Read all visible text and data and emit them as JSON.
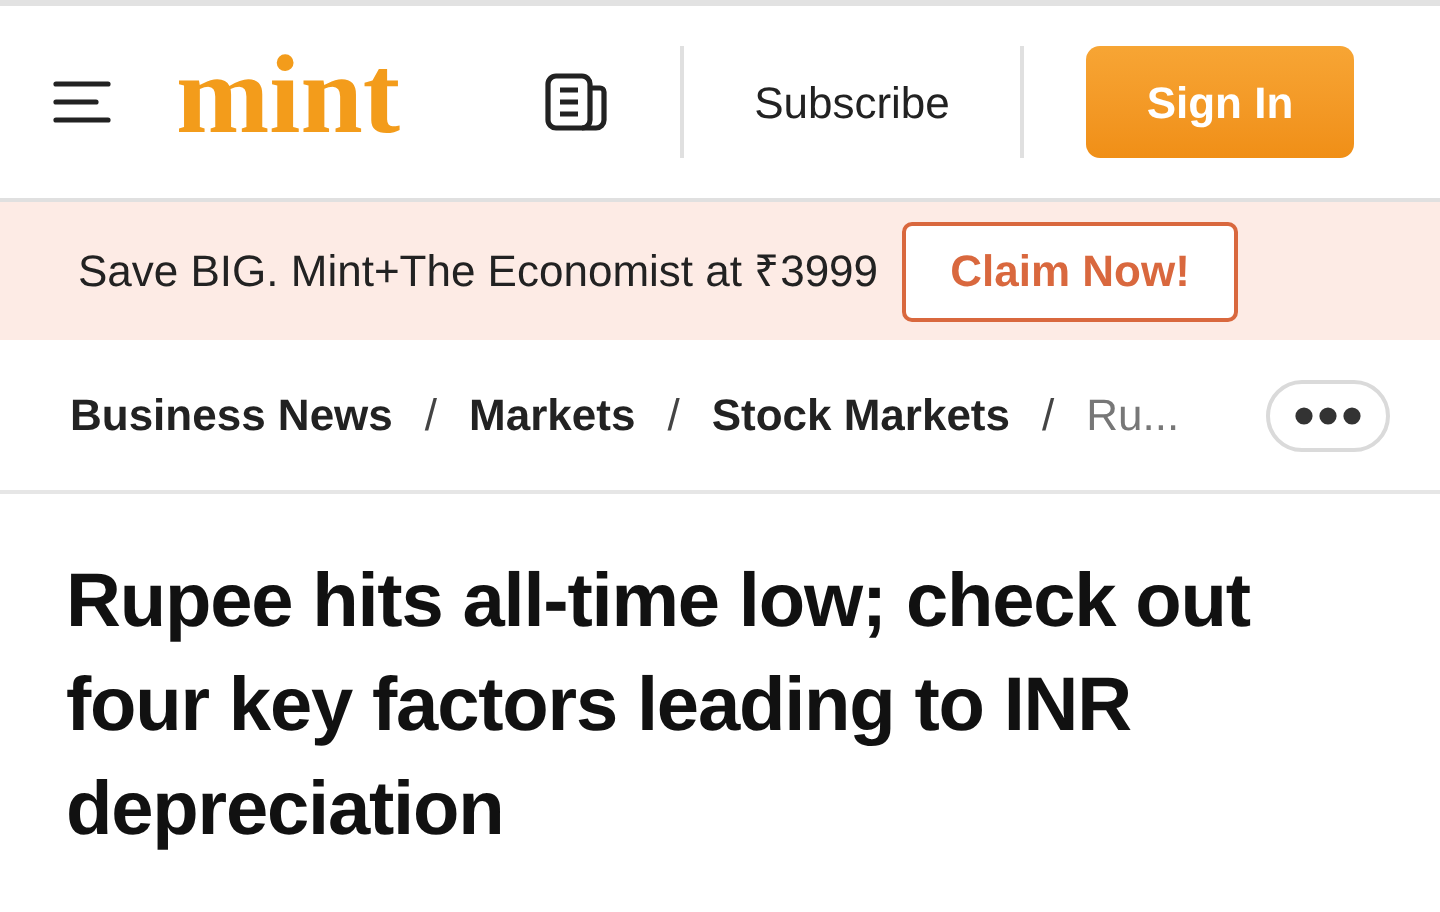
{
  "header": {
    "logo": "mint",
    "subscribe": "Subscribe",
    "sign_in": "Sign In"
  },
  "promo": {
    "text": "Save BIG. Mint+The Economist at ₹3999",
    "button": "Claim Now!"
  },
  "breadcrumbs": [
    {
      "kind": "link",
      "text": "Business News",
      "current": false
    },
    {
      "kind": "separator",
      "text": "/"
    },
    {
      "kind": "link",
      "text": "Markets",
      "current": false
    },
    {
      "kind": "separator",
      "text": "/"
    },
    {
      "kind": "link",
      "text": "Stock Markets",
      "current": false
    },
    {
      "kind": "separator",
      "text": "/"
    },
    {
      "kind": "link",
      "text": "Ru...",
      "current": true
    }
  ],
  "headline": "Rupee hits all-time low; check out four key factors leading to INR depreciation"
}
